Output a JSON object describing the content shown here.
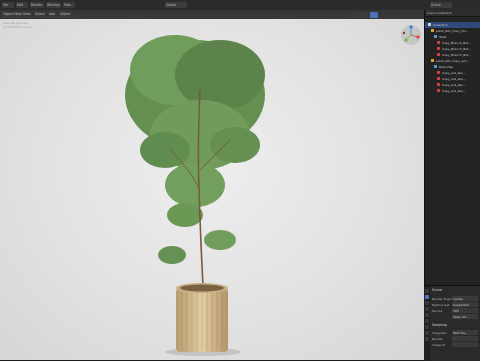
{
  "topbar": {
    "menus": [
      "File",
      "Edit",
      "Render",
      "Window",
      "Help"
    ],
    "mode": "Global",
    "scene": "Scene"
  },
  "viewport": {
    "overlay_lines": [
      "User Perspective",
      "(1) Collection | pot_..."
    ],
    "header_buttons": [
      "Object Mode",
      "View",
      "Select",
      "Add",
      "Object"
    ]
  },
  "outliner": {
    "title": "Scene Collection",
    "rows": [
      {
        "label": "Collection",
        "selected": true
      },
      {
        "label": "plant_001_Copy_Do..."
      },
      {
        "label": "Stalk"
      },
      {
        "label": "Copy_Branch_Bot..."
      },
      {
        "label": "Copy_Branch_Bot..."
      },
      {
        "label": "Copy_Branch_Bot..."
      },
      {
        "label": "plant_001_Copy_ent..."
      },
      {
        "label": "Branches"
      },
      {
        "label": "Copy_ent_abs..."
      },
      {
        "label": "Copy_ent_abs..."
      },
      {
        "label": "Copy_ent_abs..."
      },
      {
        "label": "Copy_ent_abs..."
      }
    ]
  },
  "properties": {
    "header": "Scene",
    "rows": [
      {
        "k": "Render Engine",
        "v": "Cycles"
      },
      {
        "k": "Feature Set",
        "v": "Supported"
      },
      {
        "k": "Device",
        "v": "CPU"
      },
      {
        "k": "",
        "v": "Open Sh..."
      }
    ],
    "section": "Sampling",
    "sub_rows": [
      {
        "k": "Integrator",
        "v": "Path Tra..."
      },
      {
        "k": "Render",
        "v": ""
      },
      {
        "k": "Viewport",
        "v": ""
      }
    ]
  }
}
